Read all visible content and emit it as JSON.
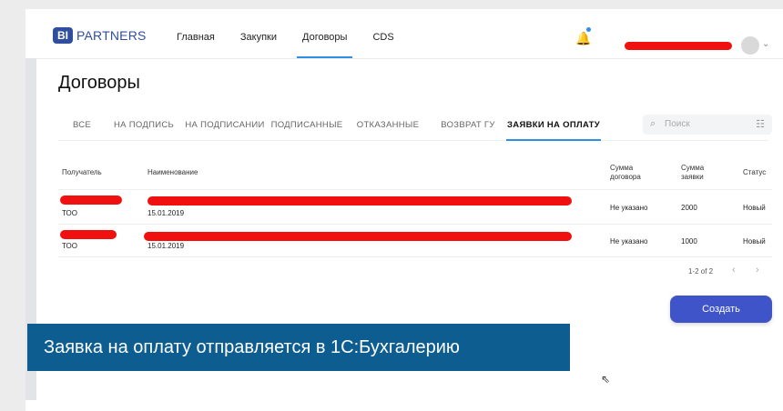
{
  "header": {
    "logo_badge": "BI",
    "logo_text": "PARTNERS",
    "nav": [
      "Главная",
      "Закупки",
      "Договоры",
      "CDS"
    ],
    "active_nav": "Договоры"
  },
  "page": {
    "title": "Договоры"
  },
  "tabs": [
    "ВСЕ",
    "НА ПОДПИСЬ",
    "НА ПОДПИСАНИИ",
    "ПОДПИСАННЫЕ",
    "ОТКАЗАННЫЕ",
    "ВОЗВРАТ ГУ",
    "ЗАЯВКИ НА ОПЛАТУ"
  ],
  "active_tab": "ЗАЯВКИ НА ОПЛАТУ",
  "search": {
    "placeholder": "Поиск"
  },
  "table": {
    "headers": {
      "recipient": "Получатель",
      "name": "Наименование",
      "contract_sum_1": "Сумма",
      "contract_sum_2": "договора",
      "request_sum_1": "Сумма",
      "request_sum_2": "заявки",
      "status": "Статус"
    },
    "rows": [
      {
        "recipient_sub": "ТОО",
        "date": "15.01.2019",
        "contract_sum": "Не указано",
        "request_sum": "2000",
        "status": "Новый"
      },
      {
        "recipient_sub": "ТОО",
        "date": "15.01.2019",
        "contract_sum": "Не указано",
        "request_sum": "1000",
        "status": "Новый"
      }
    ]
  },
  "pagination": {
    "label": "1-2 of 2"
  },
  "buttons": {
    "create": "Создать"
  },
  "caption": "Заявка на оплату отправляется в 1С:Бухгалерию",
  "colors": {
    "accent": "#2f8fe0",
    "primary_button": "#3e54c8",
    "caption_bg": "#0e5d91",
    "redaction": "#f01010"
  }
}
